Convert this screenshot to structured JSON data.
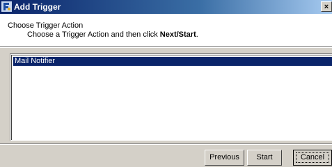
{
  "window": {
    "title": "Add Trigger",
    "close_glyph": "×",
    "icon": "trigger-app-icon"
  },
  "header": {
    "step_title": "Choose Trigger Action",
    "desc_prefix": "Choose a Trigger Action and then click ",
    "desc_bold": "Next/Start",
    "desc_suffix": "."
  },
  "list": {
    "items": [
      {
        "label": "Mail Notifier",
        "selected": true
      }
    ]
  },
  "buttons": {
    "previous": "Previous",
    "start": "Start",
    "cancel": "Cancel"
  },
  "colors": {
    "titlebar": "#0a246a",
    "selection": "#0a246a",
    "face": "#d4d0c8"
  }
}
